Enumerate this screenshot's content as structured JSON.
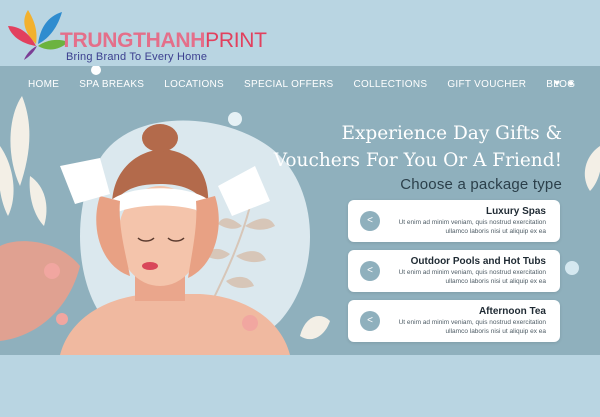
{
  "brand": {
    "name_part1": "TRUNGTHANH",
    "name_part2": "PRINT",
    "tagline": "Bring Brand To Every Home",
    "colors": {
      "pink": "#e46f8a",
      "red": "#e2405e",
      "navy": "#3b3f8f"
    }
  },
  "nav": {
    "items": [
      "HOME",
      "SPA BREAKS",
      "LOCATIONS",
      "SPECIAL OFFERS",
      "COLLECTIONS",
      "GIFT VOUCHER",
      "BLOG"
    ],
    "icons": [
      "heart-icon",
      "user-icon"
    ]
  },
  "hero": {
    "headline_line1": "Experience Day Gifts &",
    "headline_line2": "Vouchers For You Or A Friend!",
    "subhead": "Choose a package type",
    "packages": [
      {
        "title": "Luxury Spas",
        "text": "Ut enim ad minim veniam, quis nostrud exercitation ullamco laboris nisi ut aliquip ex ea",
        "button": "<"
      },
      {
        "title": "Outdoor Pools and Hot Tubs",
        "text": "Ut enim ad minim veniam, quis nostrud exercitation ullamco laboris nisi ut aliquip ex ea",
        "button": "<"
      },
      {
        "title": "Afternoon Tea",
        "text": "Ut enim ad minim veniam, quis nostrud exercitation ullamco laboris nisi ut aliquip ex ea",
        "button": "<"
      }
    ]
  },
  "colors": {
    "page_bg": "#b9d5e2",
    "hero_bg": "#8fb0bd",
    "card_bg": "#ffffff"
  }
}
